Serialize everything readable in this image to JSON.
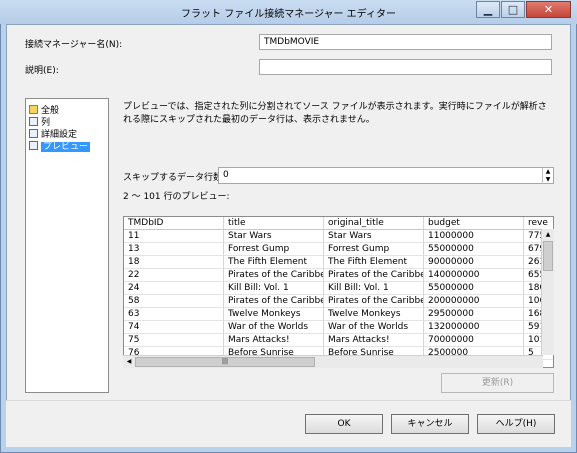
{
  "window": {
    "title": "フラット ファイル接続マネージャー エディター",
    "min_glyph": "▁",
    "max_glyph": "□",
    "close_glyph": "✕"
  },
  "form": {
    "conn_name_label": "接続マネージャー名(N):",
    "conn_name_value": "TMDbMOVIE",
    "desc_label": "説明(E):",
    "desc_value": ""
  },
  "nav": {
    "items": [
      {
        "label": "全般",
        "icon": "general-icon"
      },
      {
        "label": "列",
        "icon": "columns-icon"
      },
      {
        "label": "詳細設定",
        "icon": "advanced-icon"
      },
      {
        "label": "プレビュー",
        "icon": "preview-icon",
        "selected": true
      }
    ]
  },
  "preview": {
    "description": "プレビューでは、指定された列に分割されてソース ファイルが表示されます。実行時にファイルが解析される際にスキップされた最初のデータ行は、表示されません。",
    "skip_label": "スキップするデータ行数(A):",
    "skip_value": "0",
    "range_label": "2 ～ 101 行のプレビュー:",
    "columns": [
      "TMDbID",
      "title",
      "original_title",
      "budget",
      "reve"
    ],
    "rows": [
      [
        "11",
        "Star Wars",
        "Star Wars",
        "11000000",
        "775"
      ],
      [
        "13",
        "Forrest Gump",
        "Forrest Gump",
        "55000000",
        "679"
      ],
      [
        "18",
        "The Fifth Element",
        "The Fifth Element",
        "90000000",
        "263"
      ],
      [
        "22",
        "Pirates of the Caribbea...",
        "Pirates of the Caribbea...",
        "140000000",
        "655"
      ],
      [
        "24",
        "Kill Bill: Vol. 1",
        "Kill Bill: Vol. 1",
        "55000000",
        "180"
      ],
      [
        "58",
        "Pirates of the Caribbea...",
        "Pirates of the Caribbea...",
        "200000000",
        "106"
      ],
      [
        "63",
        "Twelve Monkeys",
        "Twelve Monkeys",
        "29500000",
        "168"
      ],
      [
        "74",
        "War of the Worlds",
        "War of the Worlds",
        "132000000",
        "591"
      ],
      [
        "75",
        "Mars Attacks!",
        "Mars Attacks!",
        "70000000",
        "101"
      ],
      [
        "76",
        "Before Sunrise",
        "Before Sunrise",
        "2500000",
        "5"
      ]
    ],
    "hscroll_thumb_glyph": "|||",
    "refresh_label": "更新(R)"
  },
  "buttons": {
    "ok": "OK",
    "cancel": "キャンセル",
    "help": "ヘルプ(H)"
  },
  "colors": {
    "selection": "#3399ff",
    "frame": "#b9d1ea"
  }
}
